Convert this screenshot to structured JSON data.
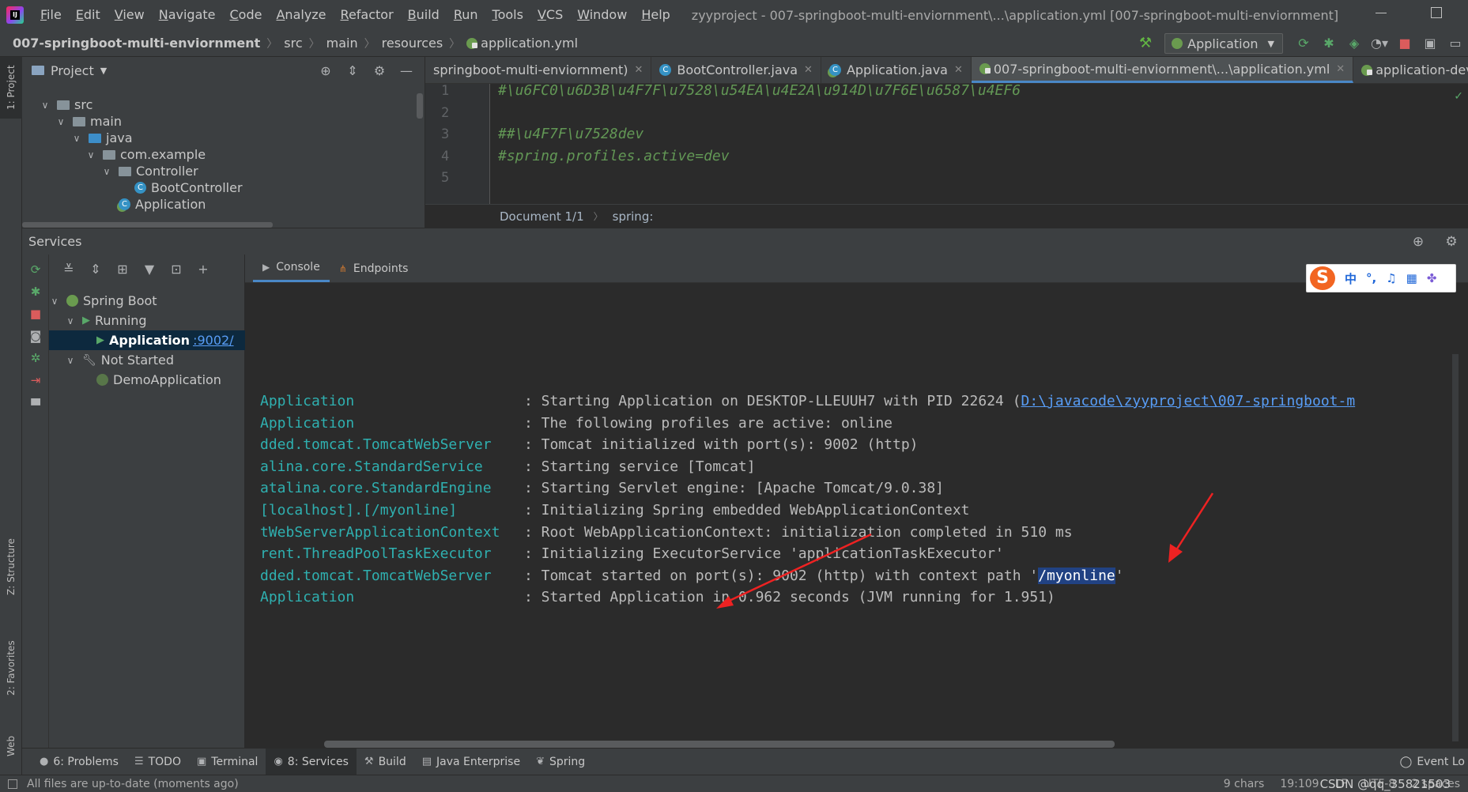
{
  "menu": {
    "items": [
      "File",
      "Edit",
      "View",
      "Navigate",
      "Code",
      "Analyze",
      "Refactor",
      "Build",
      "Run",
      "Tools",
      "VCS",
      "Window",
      "Help"
    ],
    "window_title": "zyyproject - 007-springboot-multi-enviornment\\...\\application.yml [007-springboot-multi-enviornment]"
  },
  "breadcrumb": {
    "items": [
      "007-springboot-multi-enviornment",
      "src",
      "main",
      "resources",
      "application.yml"
    ]
  },
  "run_toolbar": {
    "config_name": "Application"
  },
  "project_panel": {
    "title": "Project",
    "tree": [
      {
        "label": "src",
        "kind": "folder"
      },
      {
        "label": "main",
        "kind": "folder"
      },
      {
        "label": "java",
        "kind": "folder-blue"
      },
      {
        "label": "com.example",
        "kind": "package"
      },
      {
        "label": "Controller",
        "kind": "package"
      },
      {
        "label": "BootController",
        "kind": "class"
      },
      {
        "label": "Application",
        "kind": "spring-class"
      }
    ]
  },
  "editor_tabs": [
    {
      "label": "springboot-multi-enviornment)",
      "icon": "none",
      "active": false
    },
    {
      "label": "BootController.java",
      "icon": "class",
      "active": false
    },
    {
      "label": "Application.java",
      "icon": "spring-class",
      "active": false
    },
    {
      "label": "007-springboot-multi-enviornment\\...\\application.yml",
      "icon": "yml",
      "active": true
    },
    {
      "label": "application-dev.yml",
      "icon": "yml",
      "active": false
    }
  ],
  "editor": {
    "line_numbers": [
      "1",
      "2",
      "3",
      "4",
      "5"
    ],
    "lines": [
      "#\\u6FC0\\u6D3B\\u4F7F\\u7528\\u54EA\\u4E2A\\u914D\\u7F6E\\u6587\\u4EF6",
      "",
      "##\\u4F7F\\u7528dev",
      "#spring.profiles.active=dev",
      ""
    ],
    "status_document": "Document 1/1",
    "status_path": "spring:"
  },
  "services": {
    "title": "Services",
    "tree": {
      "spring_boot": "Spring Boot",
      "running": "Running",
      "selected_app": "Application",
      "selected_port": ":9002/",
      "not_started": "Not Started",
      "demo_app": "DemoApplication"
    },
    "tabs": {
      "console": "Console",
      "endpoints": "Endpoints"
    }
  },
  "console": {
    "lines": [
      {
        "source": "Application",
        "message": ": Starting Application on DESKTOP-LLEUUH7 with PID 22624 (",
        "link": "D:\\javacode\\zyyproject\\007-springboot-m"
      },
      {
        "source": "Application",
        "message": ": The following profiles are active: online"
      },
      {
        "source": "dded.tomcat.TomcatWebServer",
        "message": ": Tomcat initialized with port(s): 9002 (http)"
      },
      {
        "source": "alina.core.StandardService",
        "message": ": Starting service [Tomcat]"
      },
      {
        "source": "atalina.core.StandardEngine",
        "message": ": Starting Servlet engine: [Apache Tomcat/9.0.38]"
      },
      {
        "source": "[localhost].[/myonline]",
        "message": ": Initializing Spring embedded WebApplicationContext"
      },
      {
        "source": "tWebServerApplicationContext",
        "message": ": Root WebApplicationContext: initialization completed in 510 ms"
      },
      {
        "source": "rent.ThreadPoolTaskExecutor",
        "message": ": Initializing ExecutorService 'applicationTaskExecutor'"
      },
      {
        "source": "dded.tomcat.TomcatWebServer",
        "message": ": Tomcat started on port(s): 9002 (http) with context path '",
        "highlight": "/myonline",
        "suffix": "'"
      },
      {
        "source": "Application",
        "message": ": Started Application in 0.962 seconds (JVM running for 1.951)"
      }
    ]
  },
  "ime_toolbar": {
    "logo": "S",
    "mode": "中"
  },
  "left_strip": {
    "project": "1: Project",
    "structure": "Z: Structure",
    "favorites": "2: Favorites",
    "web": "Web"
  },
  "bottom_tools": [
    {
      "label": "6: Problems",
      "icon": "problems-icon",
      "active": false
    },
    {
      "label": "TODO",
      "icon": "todo-icon",
      "active": false
    },
    {
      "label": "Terminal",
      "icon": "terminal-icon",
      "active": false
    },
    {
      "label": "8: Services",
      "icon": "services-icon",
      "active": true
    },
    {
      "label": "Build",
      "icon": "hammer-icon",
      "active": false
    },
    {
      "label": "Java Enterprise",
      "icon": "java-enterprise-icon",
      "active": false
    },
    {
      "label": "Spring",
      "icon": "spring-icon",
      "active": false
    }
  ],
  "event_log": "Event Lo",
  "status_bar": {
    "message": "All files are up-to-date (moments ago)",
    "chars": "9 chars",
    "position": "19:109",
    "line_sep": "LF",
    "encoding": "UTF-8",
    "indent": "2 spaces",
    "watermark": "CSDN @qq_35821503"
  }
}
